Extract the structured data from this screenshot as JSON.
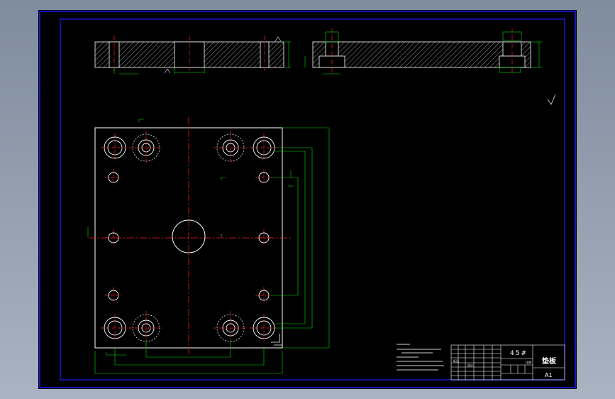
{
  "drawing": {
    "material": "45#",
    "part_name": "垫板",
    "sheet_size": "A1",
    "title_block": {
      "row_labels": [
        "标记",
        "设计"
      ],
      "scale_label": "比例"
    },
    "colors": {
      "background": "#000000",
      "frame": "#1e1eff",
      "outline": "#ffffff",
      "centerline": "#ff2020",
      "dimension": "#00e000",
      "hidden": "#ffffff",
      "hatch": "#ffffff"
    }
  }
}
